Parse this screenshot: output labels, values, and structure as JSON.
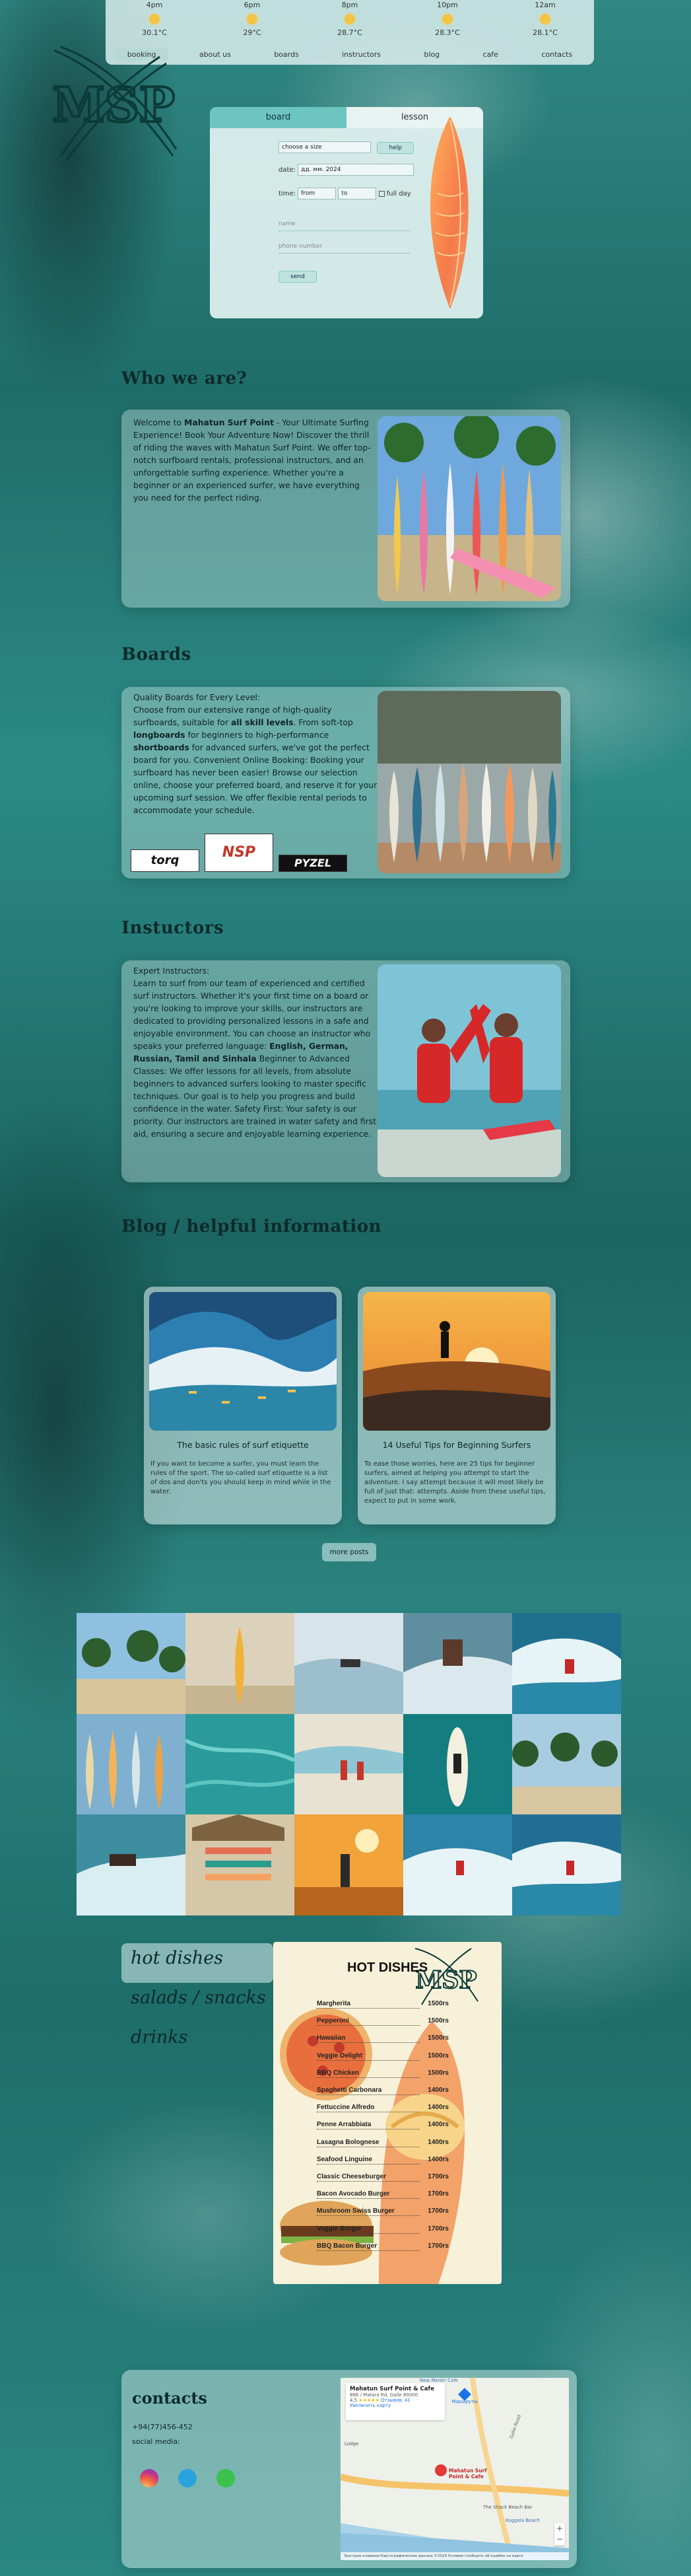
{
  "weather": [
    {
      "time": "4pm",
      "temp": "30.1°C"
    },
    {
      "time": "6pm",
      "temp": "29°C"
    },
    {
      "time": "8pm",
      "temp": "28.7°C"
    },
    {
      "time": "10pm",
      "temp": "28.3°C"
    },
    {
      "time": "12am",
      "temp": "28.1°C"
    }
  ],
  "nav": [
    "booking",
    "about us",
    "boards",
    "instructors",
    "blog",
    "cafe",
    "contacts"
  ],
  "logo_text": "MSP",
  "booking": {
    "tabs": [
      "board",
      "lesson"
    ],
    "size_placeholder": "choose a size",
    "help_label": "help",
    "date_label": "date:",
    "date_value": "дд. мм. 2024",
    "time_label": "time:",
    "from_label": "from",
    "to_label": "to",
    "fullday_label": "full day",
    "name_placeholder": "name",
    "phone_placeholder": "phone number",
    "send_label": "send"
  },
  "about": {
    "title": "Who we are?",
    "text_intro": "Welcome to ",
    "text_bold": "Mahatun Surf Point",
    "text_rest": " - Your Ultimate Surfing Experience! Book Your Adventure Now! Discover the thrill of riding the waves with Mahatun Surf Point. We offer top-notch surfboard rentals, professional instructors, and an unforgettable surfing experience. Whether you're a beginner or an experienced surfer, we have everything you need for the perfect riding."
  },
  "boards": {
    "title": "Boards",
    "p1": "Quality Boards for Every Level:",
    "p2a": "Choose from our extensive range of high-quality surfboards, suitable for ",
    "p2b": "all skill levels",
    "p2c": ". From soft-top ",
    "p2d": "longboards",
    "p2e": " for beginners to high-performance ",
    "p2f": "shortboards",
    "p2g": " for advanced surfers, we've got the perfect board for you. Convenient Online Booking: Booking your surfboard has never been easier! Browse our selection online, choose your preferred board, and reserve it for your upcoming surf session. We offer flexible rental periods to accommodate your schedule.",
    "brands": [
      "torq",
      "NSP",
      "PYZEL"
    ]
  },
  "instructors": {
    "title": "Instuctors",
    "p1": "Expert Instructors:",
    "p2a": "Learn to surf from our team of experienced and certified surf instructors. Whether it's your first time on a board or you're looking to improve your skills, our instructors are dedicated to providing personalized lessons in a safe and enjoyable environment. You can choose an instructor who speaks your preferred language: ",
    "p2b": "English, German, Russian, Tamil and Sinhala",
    "p2c": " Beginner to Advanced Classes: We offer lessons for all levels, from absolute beginners to advanced surfers looking to master specific techniques. Our goal is to help you progress and build confidence in the water. Safety First: Your safety is our priority. Our instructors are trained in water safety and first aid, ensuring a secure and enjoyable learning experience."
  },
  "blog": {
    "title": "Blog / helpful information",
    "posts": [
      {
        "title": "The basic rules of surf etiquette",
        "text": "If you want to become a surfer, you must learn the rules of the sport. The so-called surf etiquette is a list of dos and don'ts you should keep in mind while in the water."
      },
      {
        "title": "14 Useful Tips for Beginning Surfers",
        "text": "To ease those worries, here are 25 tips for beginner surfers, aimed at helping you attempt to start the adventure. I say attempt because it will most likely be full of just that: attempts. Aside from these useful tips, expect to put in some work."
      }
    ],
    "more_label": "more posts"
  },
  "cafe": {
    "tabs": [
      "hot dishes",
      "salads / snacks",
      "drinks"
    ],
    "menu_title": "HOT DISHES",
    "items": [
      {
        "name": "Margherita",
        "price": "1500rs"
      },
      {
        "name": "Pepperoni",
        "price": "1500rs"
      },
      {
        "name": "Hawaiian",
        "price": "1500rs"
      },
      {
        "name": "Veggie Delight",
        "price": "1500rs"
      },
      {
        "name": "BBQ Chicken",
        "price": "1500rs"
      },
      {
        "name": "Spaghetti Carbonara",
        "price": "1400rs"
      },
      {
        "name": "Fettuccine Alfredo",
        "price": "1400rs"
      },
      {
        "name": "Penne Arrabbiata",
        "price": "1400rs"
      },
      {
        "name": "Lasagna Bolognese",
        "price": "1400rs"
      },
      {
        "name": "Seafood Linguine",
        "price": "1400rs"
      },
      {
        "name": "Classic Cheeseburger",
        "price": "1700rs"
      },
      {
        "name": "Bacon Avocado Burger",
        "price": "1700rs"
      },
      {
        "name": "Mushroom Swiss Burger",
        "price": "1700rs"
      },
      {
        "name": "Veggie Burger",
        "price": "1700rs"
      },
      {
        "name": "BBQ Bacon Burger",
        "price": "1700rs"
      }
    ]
  },
  "contacts": {
    "title": "contacts",
    "phone": "+94(77)456-452",
    "social_label": "social media:",
    "map": {
      "place": "Mahatun Surf Point & Cafe",
      "address": "866 / Matara Rd, Galle 80000",
      "rating": "4,5",
      "reviews": "Отзывов: 41",
      "enlarge": "Увеличить карту",
      "route": "Маршруты",
      "pin_label": "Mahatun Surf Point & Cafe",
      "road": "Galle Road",
      "n1": "New Montri Cafe",
      "n2": "Lodge",
      "n3": "The Shack Beach Bar",
      "n4": "Koggala Beach",
      "footer": "Быстрые клавиши  Картографические данные ©2024  Условия  Сообщить об ошибке на карте"
    }
  },
  "colors": {
    "accent": "#6cc5c0",
    "ocean": "#1f6d6a",
    "card": "#e1f3f0"
  }
}
